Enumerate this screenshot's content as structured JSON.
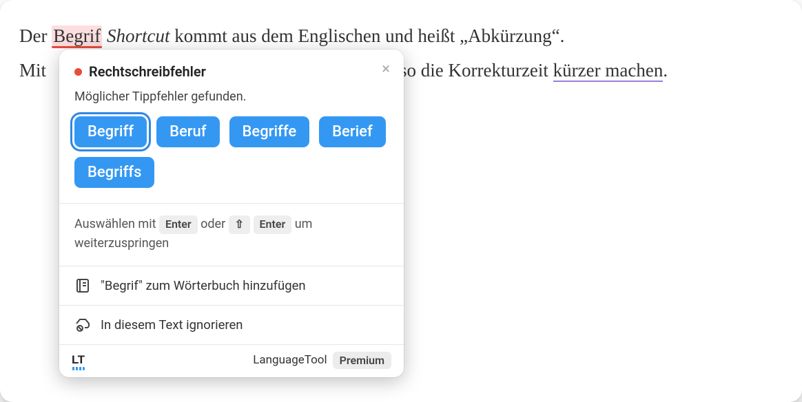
{
  "document": {
    "line1_part1": "Der ",
    "line1_err": "Begrif",
    "line1_part2": " ",
    "line1_italic": "Shortcut",
    "line1_part3": " kommt aus dem Englischen und heißt „Abkürzung“.",
    "line2_part1": "Mit ",
    "line2_part2": " also die Korrekturzeit ",
    "line2_err": "kürzer machen",
    "line2_part3": "."
  },
  "popup": {
    "title": "Rechtschreibfehler",
    "subtitle": "Möglicher Tippfehler gefunden.",
    "suggestions": [
      "Begriff",
      "Beruf",
      "Begriffe",
      "Berief",
      "Begriffs"
    ],
    "selected_index": 0,
    "hint_pre": "Auswählen mit ",
    "kbd_enter": "Enter",
    "hint_mid": " oder ",
    "kbd_shift": "⇧",
    "hint_post": " um weiterzuspringen",
    "add_dict": "\"Begrif\" zum Wörterbuch hinzufügen",
    "ignore": "In diesem Text ignorieren",
    "brand": "LT",
    "footer_label": "LanguageTool",
    "premium": "Premium"
  }
}
